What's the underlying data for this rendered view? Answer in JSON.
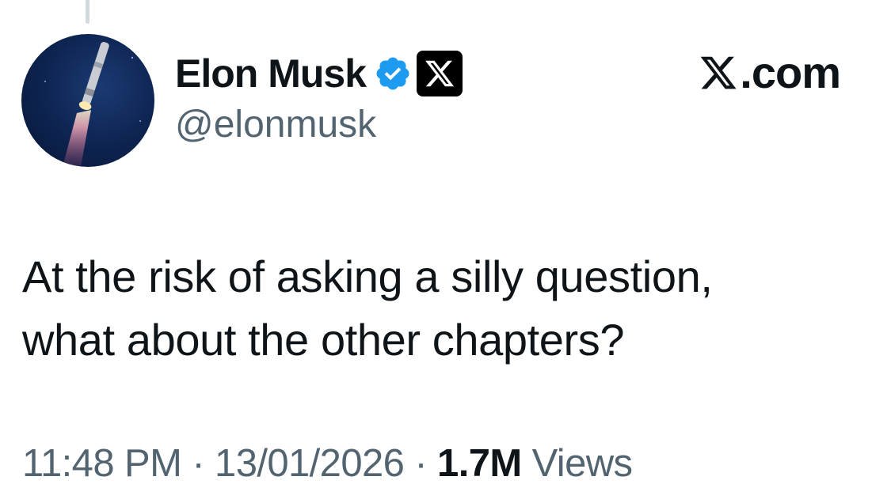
{
  "post": {
    "author": {
      "display_name": "Elon Musk",
      "handle": "@elonmusk",
      "verified": true,
      "verified_color": "#1d9bf0",
      "affiliation_icon": "x-logo-icon"
    },
    "site_label": ".com",
    "text_lines": [
      "At the risk of asking a silly question,",
      "what about the other chapters?"
    ],
    "meta": {
      "time": "11:48 PM",
      "separator": "·",
      "date": "13/01/2026",
      "views_count": "1.7M",
      "views_label": "Views"
    }
  },
  "colors": {
    "text_primary": "#0f1419",
    "text_secondary": "#536471",
    "background": "#ffffff",
    "thread_line": "#cfd9de"
  }
}
